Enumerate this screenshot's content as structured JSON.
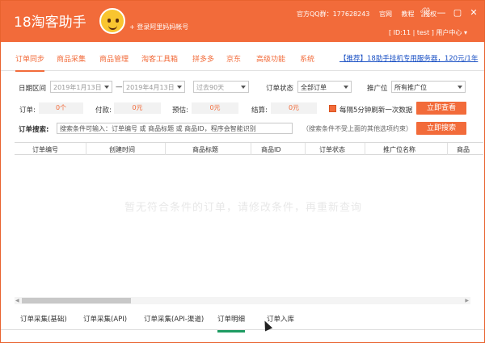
{
  "app": {
    "title": "18淘客助手",
    "login_link": "+ 登录阿里妈妈帐号"
  },
  "top_links": {
    "qq": "官方QQ群：177628243",
    "home": "官网",
    "tutorial": "教程",
    "authorize": "授权"
  },
  "window_controls": {
    "tools": "🛠",
    "min": "—",
    "max": "▢",
    "close": "✕"
  },
  "user_info": "[ ID:11 | test ] 用户中心 ▾",
  "nav": {
    "tabs": [
      "订单同步",
      "商品采集",
      "商品管理",
      "淘客工具箱",
      "拼多多",
      "京东",
      "高级功能",
      "系统"
    ],
    "promo": "【推荐】18助手挂机专用服务器，120元/1年"
  },
  "filter": {
    "date_label": "日期区间",
    "date_from": "2019年1月13日",
    "dash": "—",
    "date_to": "2019年4月13日",
    "range": "过去90天",
    "status_label": "订单状态",
    "status_value": "全部订单",
    "promo_label": "推广位",
    "promo_value": "所有推广位"
  },
  "summary": {
    "orders_label": "订单:",
    "orders_value": "0个",
    "paid_label": "付款:",
    "paid_value": "0元",
    "est_label": "预估:",
    "est_value": "0元",
    "settle_label": "结算:",
    "settle_value": "0元",
    "auto_refresh": "每隔5分钟刷新一次数据",
    "view_btn": "立即查看"
  },
  "search": {
    "label": "订单搜索:",
    "placeholder": "搜索条件可输入：订单编号 或 商品标题 或 商品ID，程序会智能识别",
    "hint": "（搜索条件不受上面的其他选项约束）",
    "btn": "立即搜索"
  },
  "table": {
    "columns": [
      "订单编号",
      "创建时间",
      "商品标题",
      "商品ID",
      "订单状态",
      "推广位名称",
      "商品"
    ],
    "empty_message": "暂无符合条件的订单，请修改条件，再重新查询"
  },
  "bottom_tabs": [
    "订单采集(基础)",
    "订单采集(API)",
    "订单采集(API-渠道)",
    "订单明细",
    "订单入库"
  ],
  "colors": {
    "accent": "#f26b3a",
    "active_tab_underline": "#1e9b63",
    "promo_link": "#1a50c4"
  }
}
